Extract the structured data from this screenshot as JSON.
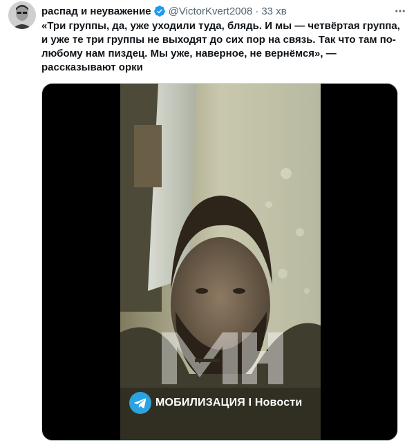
{
  "author": {
    "display_name": "распад и неуважение",
    "handle": "@VictorKvert2008",
    "separator": "·",
    "time": "33 хв",
    "avatar": "avatar-photo"
  },
  "icons": {
    "verified": "verified-badge-icon",
    "more": "more-options-icon",
    "telegram": "telegram-icon"
  },
  "colors": {
    "verified_badge": "#1d9bf0",
    "telegram_blue": "#2aa3df",
    "secondary_text": "#536471"
  },
  "tweet": {
    "text": "«Три группы, да, уже уходили туда, блядь. И мы — четвёртая группа,\nи уже те три группы не выходят до сих пор на связь. Так что там по-\nлюбому нам пиздец. Мы уже, наверное, не вернёмся», —\nрассказывают орки"
  },
  "media": {
    "type": "video",
    "watermark_logo": "MH",
    "channel_label": "МОБИЛИЗАЦИЯ I Новости"
  }
}
